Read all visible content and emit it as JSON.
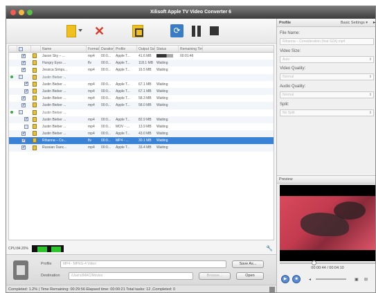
{
  "window": {
    "title": "Xilisoft Apple TV Video Converter 6"
  },
  "toolbar": {
    "add_icon": "add-file-icon",
    "remove_icon": "remove-x-icon",
    "merge_icon": "merge-icon",
    "convert_icon": "convert-icon",
    "pause_icon": "pause-icon",
    "stop_icon": "stop-icon"
  },
  "table": {
    "columns": [
      "Name",
      "Format",
      "Duration",
      "Profile",
      "Output Size",
      "Status",
      "Remaining Time"
    ],
    "rows": [
      {
        "kind": "file",
        "checked": true,
        "name": "Jason Sky – ...",
        "format": "mp4",
        "duration": "00:0...",
        "profile": "Apple T...",
        "size": "41.6 MB",
        "status": "",
        "remaining": "00:01:46",
        "progress": 0.6
      },
      {
        "kind": "file",
        "checked": true,
        "name": "Hungry Eyes ...",
        "format": "flv",
        "duration": "00:0...",
        "profile": "Apple T...",
        "size": "118.1 MB",
        "status": "Waiting",
        "remaining": ""
      },
      {
        "kind": "file",
        "checked": true,
        "name": "Jessica Simps...",
        "format": "mp4",
        "duration": "00:0...",
        "profile": "Apple T...",
        "size": "16.5 MB",
        "status": "Waiting",
        "remaining": ""
      },
      {
        "kind": "group",
        "name": "Justin Bieber ..."
      },
      {
        "kind": "sub",
        "checked": true,
        "name": "Justin Bieber ...",
        "format": "mp4",
        "duration": "00:0...",
        "profile": "Apple T...",
        "size": "67.1 MB",
        "status": "Waiting",
        "remaining": ""
      },
      {
        "kind": "sub",
        "checked": true,
        "name": "Justin Bieber ...",
        "format": "mp4",
        "duration": "00:0...",
        "profile": "Apple T...",
        "size": "67.1 MB",
        "status": "Waiting",
        "remaining": ""
      },
      {
        "kind": "file",
        "checked": true,
        "name": "Justin Bieber ...",
        "format": "mp4",
        "duration": "00:0...",
        "profile": "Apple T...",
        "size": "58.3 MB",
        "status": "Waiting",
        "remaining": ""
      },
      {
        "kind": "file",
        "checked": true,
        "name": "Justin Bieber ...",
        "format": "mp4",
        "duration": "00:0...",
        "profile": "Apple T...",
        "size": "58.0 MB",
        "status": "Waiting",
        "remaining": ""
      },
      {
        "kind": "group",
        "name": "Justin Bieber ..."
      },
      {
        "kind": "sub",
        "checked": true,
        "name": "Justin Bieber ...",
        "format": "mp4",
        "duration": "00:0...",
        "profile": "Apple T...",
        "size": "82.9 MB",
        "status": "Waiting",
        "remaining": ""
      },
      {
        "kind": "sub",
        "checked": false,
        "name": "Justin Bieber ...",
        "format": "mp4",
        "duration": "00:0...",
        "profile": "MOV - ...",
        "size": "13.9 MB",
        "status": "Waiting",
        "remaining": ""
      },
      {
        "kind": "file",
        "checked": true,
        "name": "Justin Bieber ...",
        "format": "mp4",
        "duration": "00:0...",
        "profile": "Apple T...",
        "size": "43.0 MB",
        "status": "Waiting",
        "remaining": ""
      },
      {
        "kind": "file",
        "checked": true,
        "name": "Rihanna – Co...",
        "format": "flv",
        "duration": "00:0...",
        "profile": "MP4 - ...",
        "size": "30.1 MB",
        "status": "Waiting",
        "remaining": "",
        "selected": true
      },
      {
        "kind": "file",
        "checked": true,
        "name": "Russian Danc...",
        "format": "mp4",
        "duration": "00:0...",
        "profile": "Apple T...",
        "size": "33.4 MB",
        "status": "Waiting",
        "remaining": ""
      }
    ]
  },
  "cpu": {
    "label": "CPU:84.20%",
    "tool_icon": "wrench-icon"
  },
  "output": {
    "profile_label": "Profile",
    "profile_value": "MP4 - MPEG-4 Video",
    "save_as": "Save As...",
    "destination_label": "Destination",
    "destination_value": "/Users/iMAC/Movies",
    "browse": "Browse...",
    "open": "Open"
  },
  "status_bar": {
    "text": "Completed: 1.2%  | Time Remaining: 00:29:56 Elapsed time: 00:00:21 Total tasks: 12 ,Completed: 0"
  },
  "side": {
    "header": "Profile",
    "basic_settings": "Basic Settings ▾",
    "file_name_label": "File Name:",
    "file_name_value": "Rihanna – Consideration (feat SZA).mp4",
    "video_size_label": "Video Size:",
    "video_size_value": "Auto",
    "video_quality_label": "Video Quality:",
    "video_quality_value": "Normal",
    "audio_quality_label": "Audio Quality:",
    "audio_quality_value": "Normal",
    "split_label": "Split:",
    "split_value": "No Split",
    "preview_label": "Preview",
    "timecode": "00:00:44 / 00:04:10"
  }
}
